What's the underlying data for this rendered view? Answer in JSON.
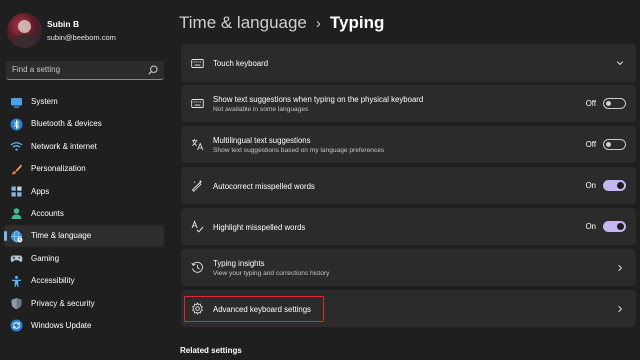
{
  "profile": {
    "name": "Subin B",
    "email": "subin@beebom.com"
  },
  "search": {
    "placeholder": "Find a setting"
  },
  "sidebar": {
    "items": [
      {
        "label": "System",
        "icon": "system-icon"
      },
      {
        "label": "Bluetooth & devices",
        "icon": "bluetooth-icon"
      },
      {
        "label": "Network & internet",
        "icon": "wifi-icon"
      },
      {
        "label": "Personalization",
        "icon": "brush-icon"
      },
      {
        "label": "Apps",
        "icon": "apps-icon"
      },
      {
        "label": "Accounts",
        "icon": "person-icon"
      },
      {
        "label": "Time & language",
        "icon": "globe-clock-icon",
        "active": true
      },
      {
        "label": "Gaming",
        "icon": "gamepad-icon"
      },
      {
        "label": "Accessibility",
        "icon": "accessibility-icon"
      },
      {
        "label": "Privacy & security",
        "icon": "shield-icon"
      },
      {
        "label": "Windows Update",
        "icon": "update-icon"
      }
    ]
  },
  "breadcrumb": {
    "parent": "Time & language",
    "separator": "›",
    "current": "Typing"
  },
  "settings": {
    "touch_keyboard": {
      "title": "Touch keyboard"
    },
    "text_suggestions": {
      "title": "Show text suggestions when typing on the physical keyboard",
      "subtitle": "Not available in some languages",
      "state": "Off"
    },
    "multilingual": {
      "title": "Multilingual text suggestions",
      "subtitle": "Show text suggestions based on my language preferences",
      "state": "Off"
    },
    "autocorrect": {
      "title": "Autocorrect misspelled words",
      "state": "On"
    },
    "highlight": {
      "title": "Highlight misspelled words",
      "state": "On"
    },
    "insights": {
      "title": "Typing insights",
      "subtitle": "View your typing and corrections history"
    },
    "advanced": {
      "title": "Advanced keyboard settings"
    }
  },
  "related": {
    "heading": "Related settings"
  },
  "colors": {
    "accent": "#76b9ed",
    "toggle_on": "#c5b6f0",
    "highlight_box": "#e0262f"
  }
}
